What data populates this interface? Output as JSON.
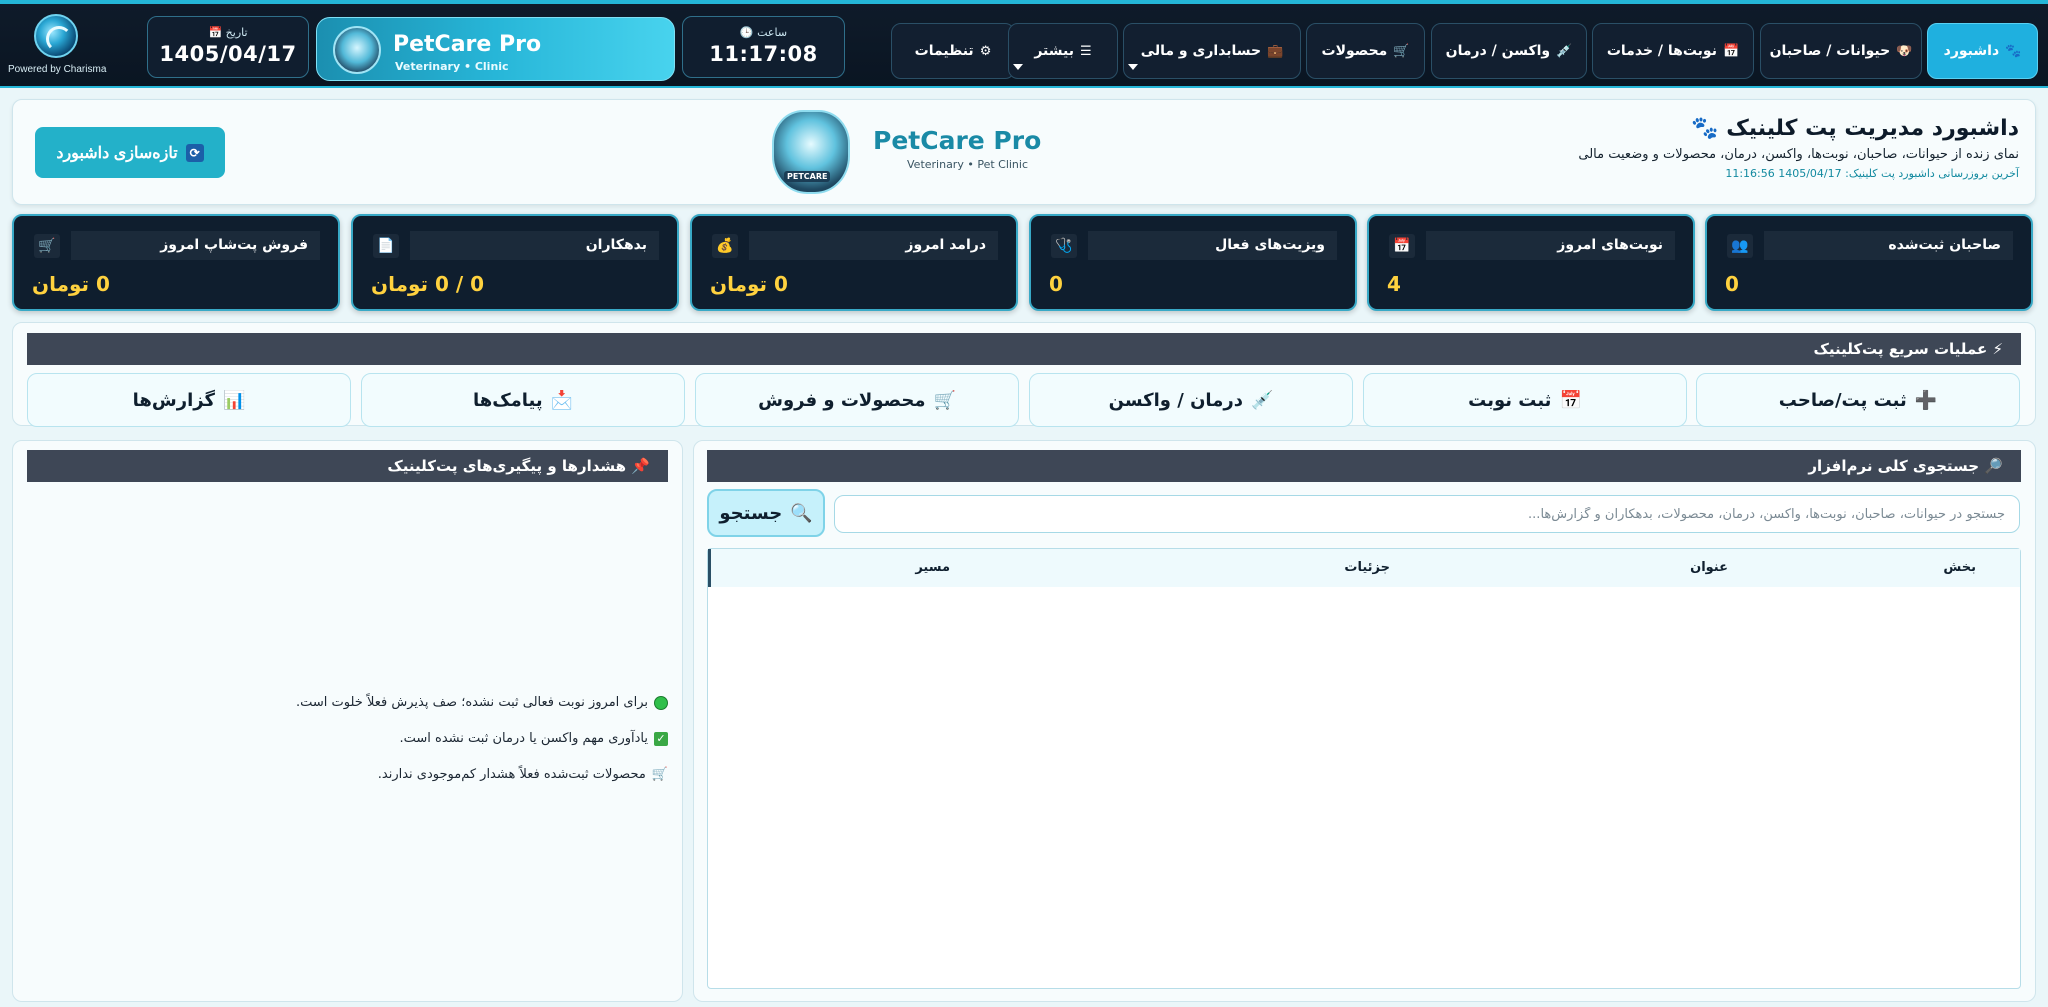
{
  "topbar": {
    "powered_by": "Powered by Charisma",
    "date": {
      "caption": "تاریخ",
      "value": "1405/04/17"
    },
    "clock": {
      "caption": "ساعت",
      "value": "11:17:08"
    },
    "brand": {
      "name": "PetCare Pro",
      "subtitle": "Veterinary • Clinic"
    },
    "nav": [
      {
        "label": "داشبورد",
        "icon": "🐾",
        "active": true
      },
      {
        "label": "حیوانات / صاحبان",
        "icon": "🐶"
      },
      {
        "label": "نوبت‌ها / خدمات",
        "icon": "📅"
      },
      {
        "label": "واکسن / درمان",
        "icon": "💉"
      },
      {
        "label": "محصولات",
        "icon": "🛒"
      },
      {
        "label": "حسابداری و مالی",
        "icon": "💼",
        "dropdown": true
      },
      {
        "label": "بیشتر",
        "icon": "☰",
        "dropdown": true
      },
      {
        "label": "تنظیمات",
        "icon": "⚙"
      }
    ]
  },
  "header": {
    "refresh_label": "تازه‌سازی داشبورد",
    "center_name": "PetCare Pro",
    "center_sub": "Veterinary • Pet Clinic",
    "title": "داشبورد مدیریت پت کلینیک",
    "description": "نمای زنده از حیوانات، صاحبان، نوبت‌ها، واکسن، درمان، محصولات و وضعیت مالی",
    "updated_label": "آخرین بروزرسانی داشبورد پت کلینیک:",
    "updated_value": "1405/04/17  11:16:56"
  },
  "stats": [
    {
      "label": "صاحبان ثبت‌شده",
      "value": "0",
      "icon": "👥"
    },
    {
      "label": "نوبت‌های امروز",
      "value": "4",
      "icon": "📅"
    },
    {
      "label": "ویزیت‌های فعال",
      "value": "0",
      "icon": "🩺"
    },
    {
      "label": "درامد امروز",
      "value": "0 تومان",
      "icon": "💰"
    },
    {
      "label": "بدهکاران",
      "value": "0 / 0 تومان",
      "icon": "📄"
    },
    {
      "label": "فروش پت‌شاپ امروز",
      "value": "0 تومان",
      "icon": "🛒"
    }
  ],
  "quick_ops": {
    "title": "عملیات سریع پت‌کلینیک",
    "title_icon": "⚡",
    "buttons": [
      {
        "label": "ثبت پت/صاحب",
        "icon": "➕"
      },
      {
        "label": "ثبت نوبت",
        "icon": "📅"
      },
      {
        "label": "درمان / واکسن",
        "icon": "💉"
      },
      {
        "label": "محصولات و فروش",
        "icon": "🛒"
      },
      {
        "label": "پیامک‌ها",
        "icon": "📩"
      },
      {
        "label": "گزارش‌ها",
        "icon": "📊"
      }
    ]
  },
  "search": {
    "title": "جستجوی کلی نرم‌افزار",
    "title_icon": "🔎",
    "button_label": "جستجو",
    "placeholder": "جستجو در حیوانات، صاحبان، نوبت‌ها، واکسن، درمان، محصولات، بدهکاران و گزارش‌ها...",
    "columns": [
      "بخش",
      "عنوان",
      "جزئیات",
      "مسیر"
    ]
  },
  "alerts": {
    "title": "هشدارها و پیگیری‌های پت‌کلینیک",
    "title_icon": "📌",
    "items": [
      {
        "text": "برای امروز نوبت فعالی ثبت نشده؛ صف پذیرش فعلاً خلوت است.",
        "icon": "green-circle"
      },
      {
        "text": "یادآوری مهم واکسن یا درمان ثبت نشده است.",
        "icon": "check"
      },
      {
        "text": "محصولات ثبت‌شده فعلاً هشدار کم‌موجودی ندارند.",
        "icon": "cart"
      }
    ]
  }
}
